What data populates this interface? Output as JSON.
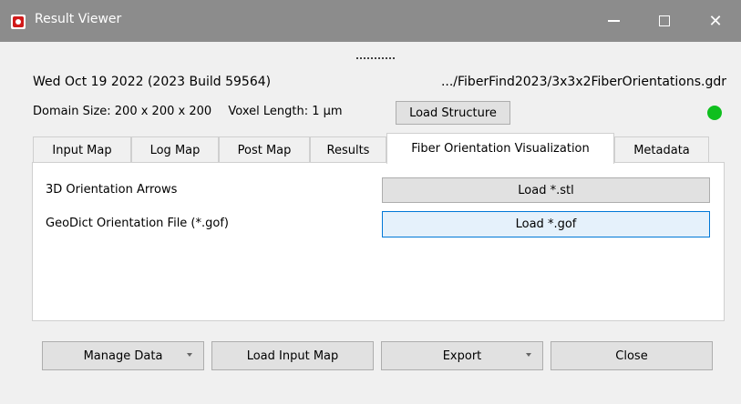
{
  "window": {
    "title": "Result Viewer"
  },
  "header": {
    "date_build": "Wed Oct 19 2022 (2023 Build 59564)",
    "file_path": ".../FiberFind2023/3x3x2FiberOrientations.gdr",
    "domain_size": "Domain Size: 200 x 200 x 200",
    "voxel_length": "Voxel Length: 1 µm",
    "load_structure": "Load Structure",
    "status_color": "#0fbf1e"
  },
  "tabs": [
    {
      "label": "Input Map"
    },
    {
      "label": "Log Map"
    },
    {
      "label": "Post Map"
    },
    {
      "label": "Results"
    },
    {
      "label": "Fiber Orientation Visualization"
    },
    {
      "label": "Metadata"
    }
  ],
  "active_tab": "Fiber Orientation Visualization",
  "panel": {
    "rows": [
      {
        "label": "3D Orientation Arrows",
        "button": "Load *.stl"
      },
      {
        "label": "GeoDict Orientation File (*.gof)",
        "button": "Load *.gof"
      }
    ]
  },
  "footer": {
    "manage_data": "Manage Data",
    "load_input_map": "Load Input Map",
    "export": "Export",
    "close": "Close"
  }
}
